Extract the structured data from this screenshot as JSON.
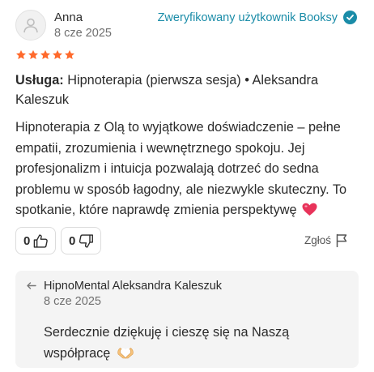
{
  "review": {
    "author": "Anna",
    "date": "8 cze 2025",
    "verified_label": "Zweryfikowany użytkownik Booksy",
    "rating": 5,
    "star_color": "#ff6a2c",
    "service_label": "Usługa:",
    "service_value": "Hipnoterapia (pierwsza sesja) • Aleksandra Kaleszuk",
    "text": "Hipnoterapia z Olą to wyjątkowe doświadczenie – pełne empatii, zrozumienia i wewnętrznego spokoju. Jej profesjonalizm i intuicja pozwalają dotrzeć do sedna problemu w sposób łagodny, ale niezwykle skuteczny. To spotkanie, które naprawdę zmienia perspektywę",
    "emoji": "heart-emoji"
  },
  "actions": {
    "upvote_count": "0",
    "downvote_count": "0",
    "report_label": "Zgłoś"
  },
  "reply": {
    "author": "HipnoMental Aleksandra Kaleszuk",
    "date": "8 cze 2025",
    "text": "Serdecznie dziękuję i cieszę się na Naszą współpracę",
    "emoji": "heart-hands-emoji"
  },
  "colors": {
    "accent": "#1a8ca8",
    "star": "#ff6a2c",
    "heart": "#e8335a",
    "reply_bg": "#f4f4f4"
  }
}
